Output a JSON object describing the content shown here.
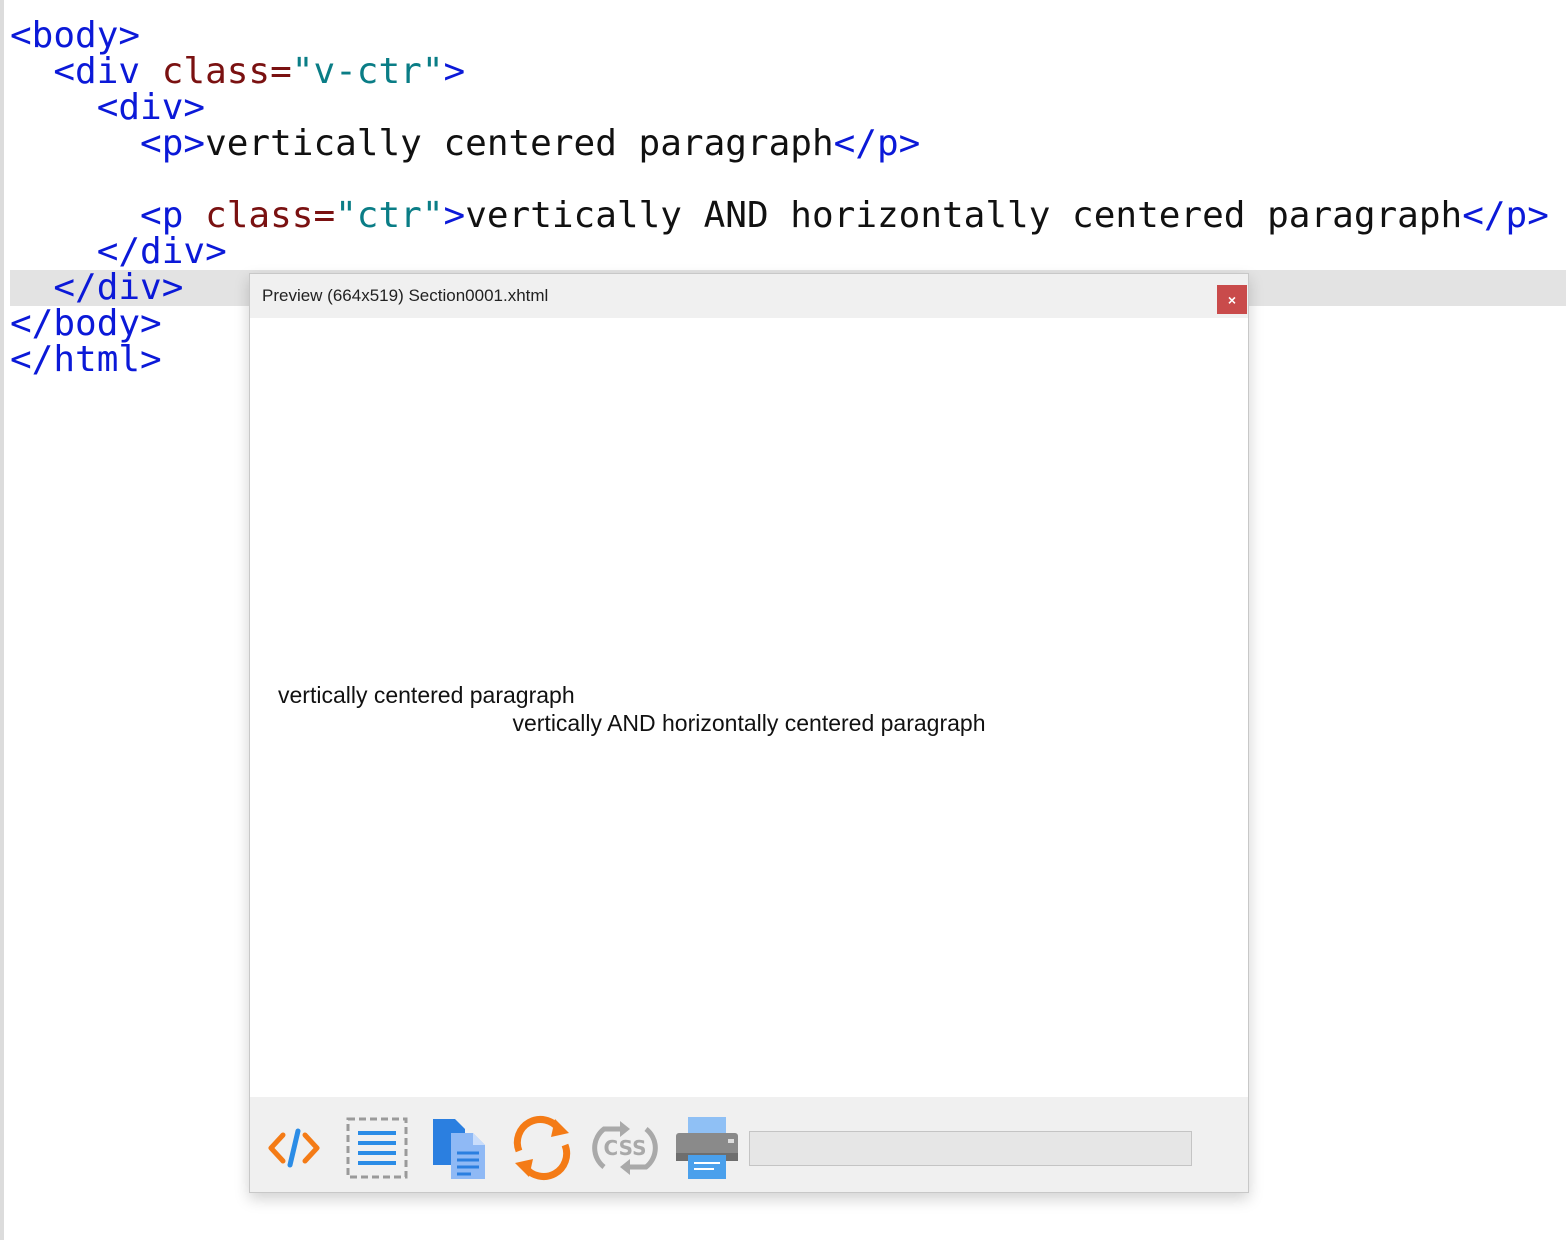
{
  "editor": {
    "lines": [
      {
        "indent": "",
        "parts": [
          [
            "tag",
            "<body>"
          ]
        ]
      },
      {
        "indent": "  ",
        "parts": [
          [
            "tag",
            "<div "
          ],
          [
            "attr",
            "class="
          ],
          [
            "val",
            "\"v-ctr\""
          ],
          [
            "tag",
            ">"
          ]
        ]
      },
      {
        "indent": "    ",
        "parts": [
          [
            "tag",
            "<div>"
          ]
        ]
      },
      {
        "indent": "      ",
        "parts": [
          [
            "tag",
            "<p>"
          ],
          [
            "txt",
            "vertically centered paragraph"
          ],
          [
            "tag",
            "</p>"
          ]
        ]
      },
      {
        "indent": "",
        "parts": []
      },
      {
        "indent": "      ",
        "parts": [
          [
            "tag",
            "<p "
          ],
          [
            "attr",
            "class="
          ],
          [
            "val",
            "\"ctr\""
          ],
          [
            "tag",
            ">"
          ],
          [
            "txt",
            "vertically AND horizontally centered paragraph"
          ],
          [
            "tag",
            "</p>"
          ]
        ]
      },
      {
        "indent": "    ",
        "parts": [
          [
            "tag",
            "</div>"
          ]
        ]
      },
      {
        "indent": "  ",
        "parts": [
          [
            "tag",
            "</div>"
          ]
        ],
        "current": true
      },
      {
        "indent": "",
        "parts": [
          [
            "tag",
            "</body>"
          ]
        ]
      },
      {
        "indent": "",
        "parts": [
          [
            "tag",
            "</html>"
          ]
        ]
      }
    ]
  },
  "preview": {
    "title": "Preview (664x519) Section0001.xhtml",
    "close_label": "×",
    "paragraph_left": "vertically centered paragraph",
    "paragraph_center": "vertically AND horizontally centered paragraph",
    "toolbar": [
      {
        "name": "code-view-icon"
      },
      {
        "name": "select-all-icon"
      },
      {
        "name": "copy-document-icon"
      },
      {
        "name": "refresh-icon"
      },
      {
        "name": "css-toggle-icon"
      },
      {
        "name": "print-icon"
      }
    ],
    "status_text": ""
  },
  "colors": {
    "tag": "#0b19d8",
    "attribute": "#7a1111",
    "value": "#0a7d86",
    "close_button": "#c94b4b",
    "orange_icon": "#f47b16",
    "blue_icon": "#2b8ce6"
  }
}
